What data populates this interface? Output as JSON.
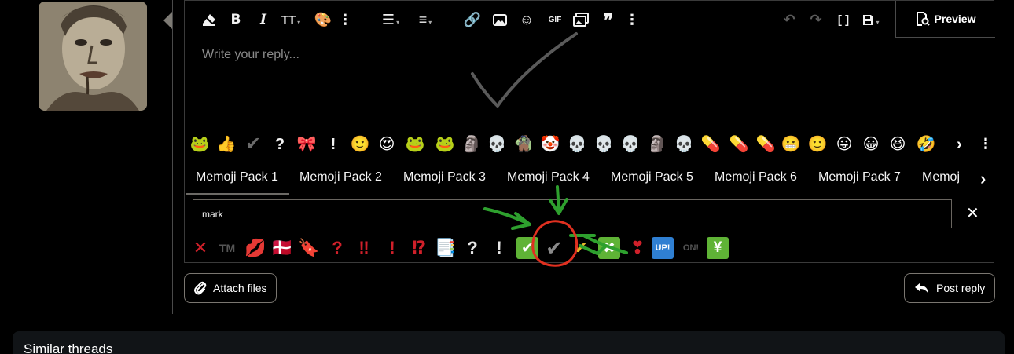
{
  "post": {
    "avatar_alt": "User avatar portrait"
  },
  "toolbar": {
    "icons": [
      "eraser-icon",
      "bold-icon",
      "italic-icon",
      "text-size-icon",
      "palette-icon",
      "more-vertical-icon",
      "bullet-list-icon",
      "align-icon",
      "link-icon",
      "image-icon",
      "smiley-icon",
      "gif-icon",
      "media-icon",
      "quote-icon",
      "more-vertical-icon",
      "undo-icon",
      "redo-icon",
      "bbcode-icon",
      "save-draft-icon"
    ],
    "gif_label": "GIF",
    "preview_label": "Preview"
  },
  "editor": {
    "placeholder": "Write your reply..."
  },
  "recent_emojis": [
    "🐸",
    "👍",
    "✔",
    "?",
    "🎀",
    "!",
    "🙂",
    "😍",
    "🐸",
    "🐸",
    "🗿",
    "💀",
    "🧌",
    "🤡",
    "💀",
    "💀",
    "💀",
    "🗿",
    "💀",
    "💊",
    "💊",
    "💊",
    "😬",
    "🙂",
    "😛",
    "😀",
    "😆",
    "🤣"
  ],
  "emoji_tabs": [
    "Memoji Pack 1",
    "Memoji Pack 2",
    "Memoji Pack 3",
    "Memoji Pack 4",
    "Memoji Pack 5",
    "Memoji Pack 6",
    "Memoji Pack 7",
    "Memoji"
  ],
  "active_tab": "Memoji Pack 1",
  "search": {
    "value": "mark"
  },
  "search_results": [
    {
      "glyph": "✕",
      "name": "cross-mark",
      "color": "#d0202a"
    },
    {
      "glyph": "TM",
      "name": "trade-mark",
      "color": "#555555"
    },
    {
      "glyph": "💋",
      "name": "kiss-mark",
      "color": "#d0202a"
    },
    {
      "glyph": "🇩🇰",
      "name": "flag-denmark",
      "color": "#c8102e"
    },
    {
      "glyph": "🔖",
      "name": "bookmark",
      "color": "#d0202a"
    },
    {
      "glyph": "?",
      "name": "red-question-mark",
      "color": "#d0202a"
    },
    {
      "glyph": "‼",
      "name": "double-exclamation-mark",
      "color": "#d0202a"
    },
    {
      "glyph": "!",
      "name": "red-exclamation-mark",
      "color": "#d0202a"
    },
    {
      "glyph": "⁉",
      "name": "exclamation-question-mark",
      "color": "#d0202a"
    },
    {
      "glyph": "📑",
      "name": "bookmark-tabs",
      "color": "#8fa6c9"
    },
    {
      "glyph": "?",
      "name": "white-question-mark",
      "color": "#e6e6e6"
    },
    {
      "glyph": "!",
      "name": "white-exclamation-mark",
      "color": "#e6e6e6"
    },
    {
      "glyph": "✔",
      "name": "check-mark-button",
      "color": "#5fb336"
    },
    {
      "glyph": "✔",
      "name": "check-mark",
      "color": "#8a8a8a"
    },
    {
      "glyph": "✔",
      "name": "check-mark-yellow",
      "color": "#e3b82a"
    },
    {
      "glyph": "✖",
      "name": "cross-mark-button",
      "color": "#5fb336"
    },
    {
      "glyph": "❣",
      "name": "heart-exclamation",
      "color": "#d0202a"
    },
    {
      "glyph": "UP!",
      "name": "up-button",
      "color": "#2f7fd2"
    },
    {
      "glyph": "ON!",
      "name": "on-arrow",
      "color": "#555555"
    },
    {
      "glyph": "¥",
      "name": "chart-increasing-yen",
      "color": "#5fb336"
    }
  ],
  "actions": {
    "attach_label": "Attach files",
    "post_label": "Post reply"
  },
  "similar": {
    "title": "Similar threads"
  },
  "colors": {
    "background": "#000000",
    "border": "#3a3a3a",
    "annotation_green": "#2ea02e",
    "annotation_red": "#e03020"
  }
}
